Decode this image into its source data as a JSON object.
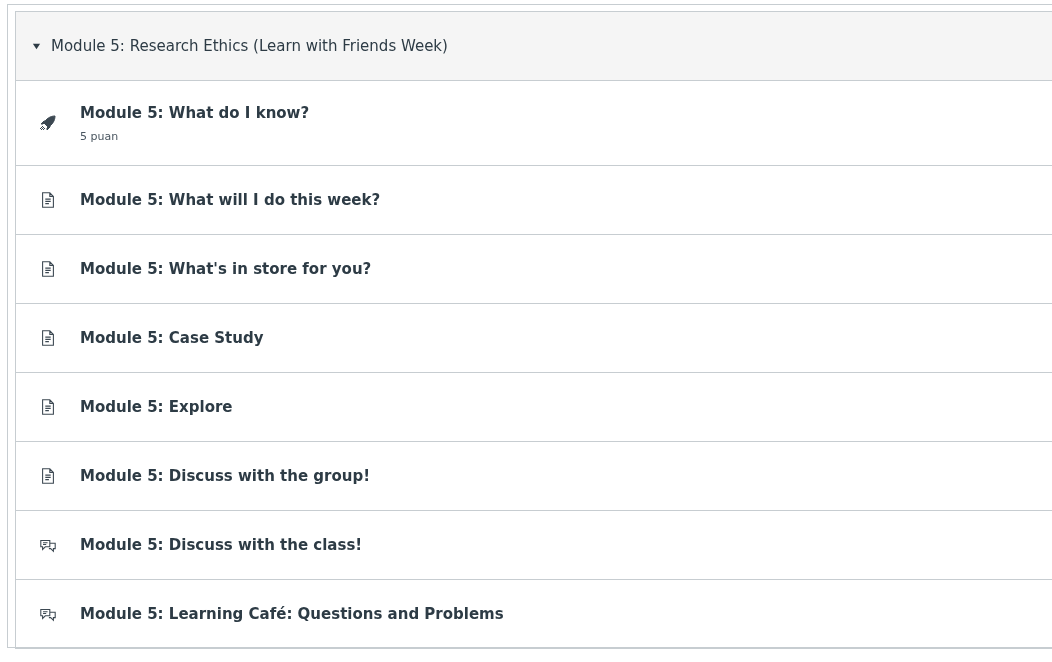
{
  "module": {
    "title": "Module 5: Research Ethics (Learn with Friends Week)",
    "expanded": true
  },
  "items": [
    {
      "kind": "quiz",
      "title": "Module 5: What do I know?",
      "points": "5 puan"
    },
    {
      "kind": "page",
      "title": "Module 5: What will I do this week?"
    },
    {
      "kind": "page",
      "title": "Module 5: What's in store for you?"
    },
    {
      "kind": "page",
      "title": "Module 5: Case Study"
    },
    {
      "kind": "page",
      "title": "Module 5: Explore"
    },
    {
      "kind": "page",
      "title": "Module 5: Discuss with the group!"
    },
    {
      "kind": "discussion",
      "title": "Module 5: Discuss with the class!"
    },
    {
      "kind": "discussion",
      "title": "Module 5: Learning Café: Questions and Problems"
    }
  ]
}
